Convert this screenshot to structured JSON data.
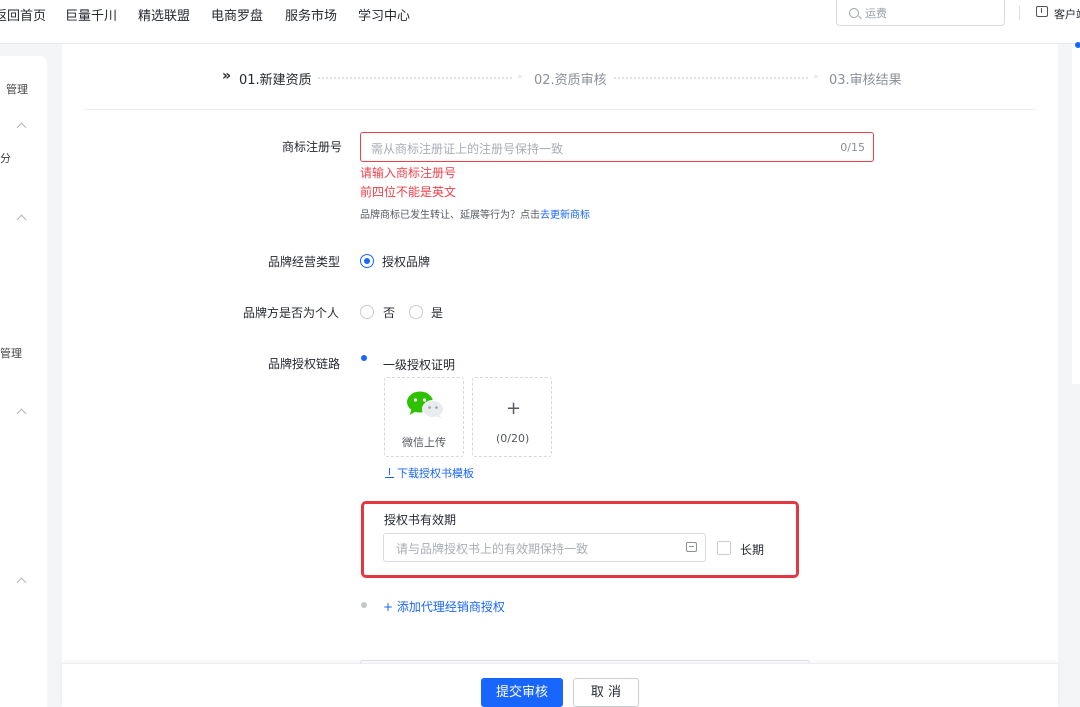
{
  "topnav": {
    "items": [
      "返回首页",
      "巨量千川",
      "精选联盟",
      "电商罗盘",
      "服务市场",
      "学习中心"
    ],
    "search_placeholder": "运费",
    "client_label": "客户端"
  },
  "sidebar": {
    "labels": [
      "管理",
      "分",
      "管理"
    ]
  },
  "steps": [
    {
      "label": "01.新建资质",
      "state": "active"
    },
    {
      "label": "02.资质审核",
      "state": "inactive"
    },
    {
      "label": "03.审核结果",
      "state": "inactive"
    }
  ],
  "form": {
    "trademark": {
      "label": "商标注册号",
      "placeholder": "需从商标注册证上的注册号保持一致",
      "counter": "0/15",
      "errors": [
        "请输入商标注册号",
        "前四位不能是英文"
      ],
      "hint_prefix": "品牌商标已发生转让、延展等行为？点击",
      "hint_link": "去更新商标"
    },
    "brand_type": {
      "label": "品牌经营类型",
      "options": [
        {
          "label": "授权品牌",
          "selected": true
        }
      ]
    },
    "is_individual": {
      "label": "品牌方是否为个人",
      "options": [
        {
          "label": "否",
          "selected": false
        },
        {
          "label": "是",
          "selected": false
        }
      ]
    },
    "auth_chain": {
      "label": "品牌授权链路",
      "level1_title": "一级授权证明",
      "wechat_upload": "微信上传",
      "upload_count": "(0/20)",
      "download_link": "下载授权书模板",
      "validity_title": "授权书有效期",
      "validity_placeholder": "请与品牌授权书上的有效期保持一致",
      "long_term": "长期",
      "add_agent": "+ 添加代理经销商授权"
    }
  },
  "actions": {
    "submit": "提交审核",
    "cancel": "取 消"
  },
  "colors": {
    "accent": "#1966ff",
    "error": "#f2404a",
    "highlight": "#e4373f"
  }
}
